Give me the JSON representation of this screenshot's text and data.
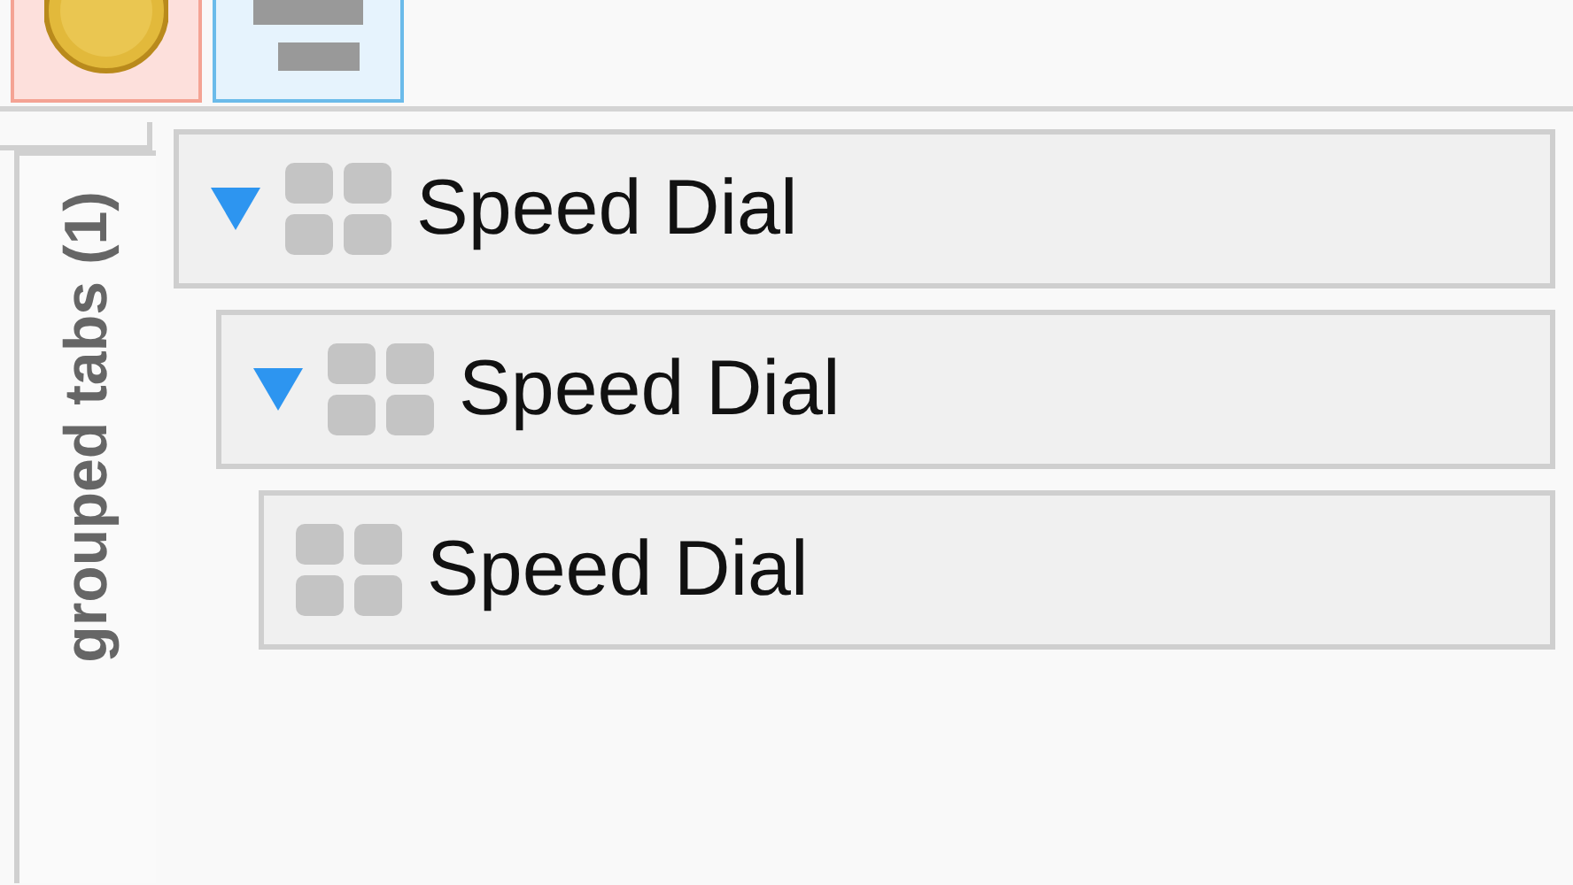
{
  "toolbar": {
    "buttons": [
      {
        "kind": "coin"
      },
      {
        "kind": "panel"
      }
    ]
  },
  "sidebar_tab": {
    "label": "grouped tabs (1)"
  },
  "tree": [
    {
      "title": "Speed Dial",
      "expanded": true,
      "children": [
        {
          "title": "Speed Dial",
          "expanded": true,
          "children": [
            {
              "title": "Speed Dial"
            }
          ]
        }
      ]
    }
  ]
}
